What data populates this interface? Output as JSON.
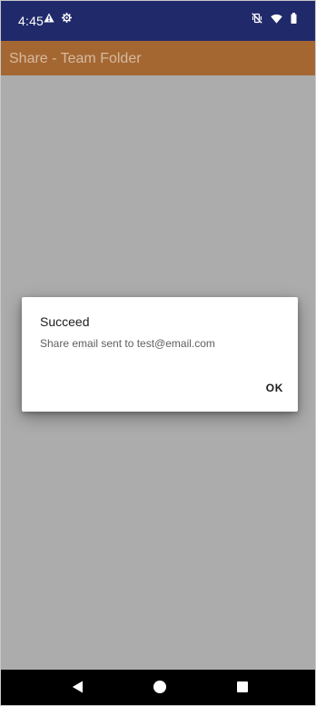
{
  "status_bar": {
    "time": "4:45",
    "icons": [
      "warning-icon",
      "settings-gear-icon",
      "vibrate-mute-icon",
      "wifi-icon",
      "battery-icon"
    ]
  },
  "app_bar": {
    "title": "Share - Team Folder"
  },
  "dialog": {
    "title": "Succeed",
    "message": "Share email sent to test@email.com",
    "ok_label": "OK"
  },
  "nav_bar": {
    "buttons": [
      "back-icon",
      "home-icon",
      "recents-icon"
    ]
  },
  "colors": {
    "status_bar": "#202a6b",
    "app_bar": "#a46732",
    "scrim": "#acacac"
  }
}
